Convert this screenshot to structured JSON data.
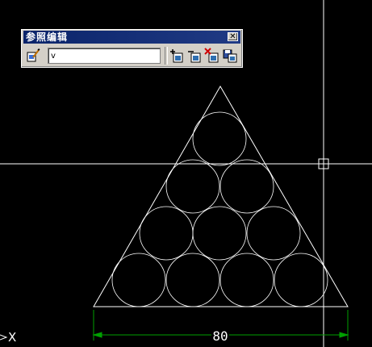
{
  "toolbar": {
    "title": "参照编辑",
    "close_symbol": "✕",
    "reference_name": "v",
    "icons": [
      "edit-reference-icon",
      "add-to-working-set-icon",
      "remove-from-working-set-icon",
      "discard-changes-icon",
      "save-back-changes-icon"
    ]
  },
  "drawing": {
    "dimension_text": "80",
    "ucs_axis_label": "X",
    "line_color": "#ffffff",
    "dimension_color": "#00a000"
  }
}
